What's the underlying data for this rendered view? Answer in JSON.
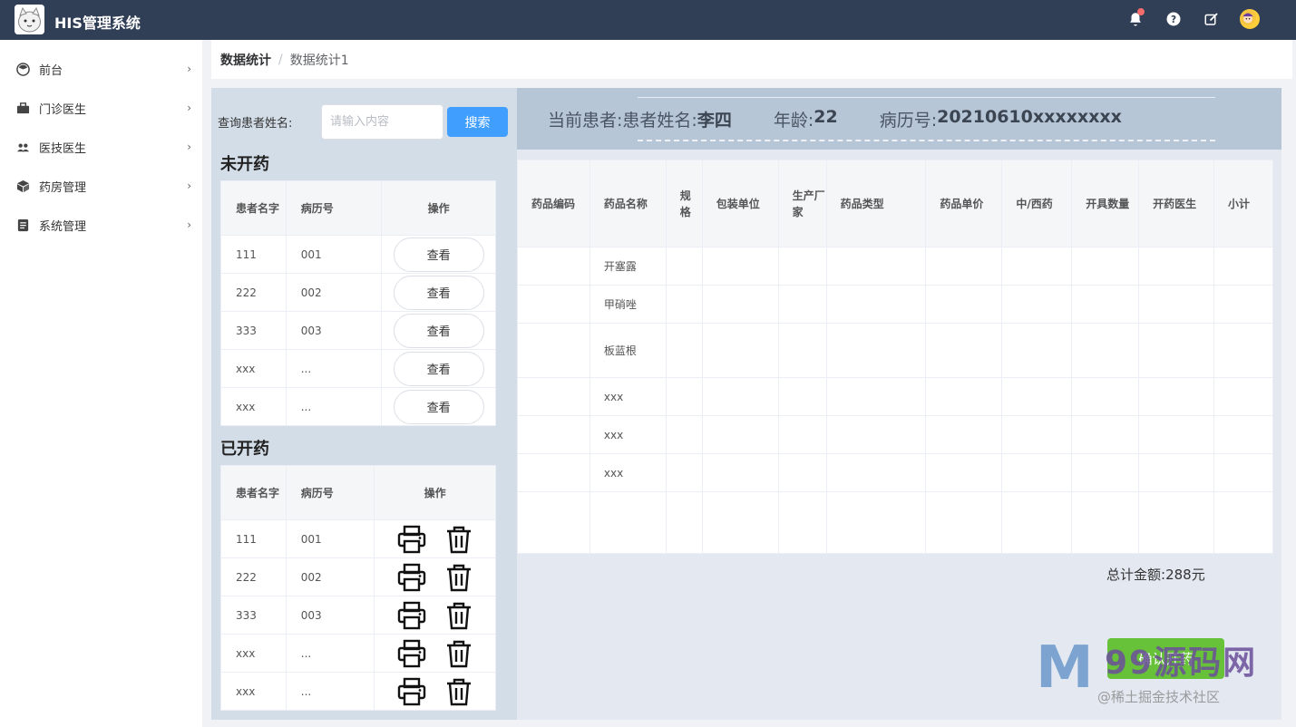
{
  "app": {
    "title": "HIS管理系统"
  },
  "sidebar": {
    "items": [
      {
        "label": "前台",
        "icon": "dashboard-icon"
      },
      {
        "label": "门诊医生",
        "icon": "briefcase-icon"
      },
      {
        "label": "医技医生",
        "icon": "users-icon"
      },
      {
        "label": "药房管理",
        "icon": "box-icon"
      },
      {
        "label": "系统管理",
        "icon": "document-icon"
      }
    ]
  },
  "breadcrumb": {
    "level1": "数据统计",
    "separator": "/",
    "level2": "数据统计1"
  },
  "search": {
    "label": "查询患者姓名:",
    "placeholder": "请输入内容",
    "button": "搜索"
  },
  "pending": {
    "title": "未开药",
    "headers": [
      "患者名字",
      "病历号",
      "操作"
    ],
    "action_label": "查看",
    "rows": [
      {
        "name": "111",
        "record": "001"
      },
      {
        "name": "222",
        "record": "002"
      },
      {
        "name": "333",
        "record": "003"
      },
      {
        "name": "xxx",
        "record": "..."
      },
      {
        "name": "xxx",
        "record": "..."
      }
    ]
  },
  "prescribed": {
    "title": "已开药",
    "headers": [
      "患者名字",
      "病历号",
      "操作"
    ],
    "rows": [
      {
        "name": "111",
        "record": "001"
      },
      {
        "name": "222",
        "record": "002"
      },
      {
        "name": "333",
        "record": "003"
      },
      {
        "name": "xxx",
        "record": "..."
      },
      {
        "name": "xxx",
        "record": "..."
      }
    ]
  },
  "patient": {
    "prefix": "当前患者:",
    "name_label": "患者姓名:",
    "name": "李四",
    "age_label": "年龄:",
    "age": "22",
    "record_label": "病历号:",
    "record": "20210610xxxxxxxx"
  },
  "drugs": {
    "headers": [
      "药品编码",
      "药品名称",
      "规格",
      "包装单位",
      "生产厂家",
      "药品类型",
      "药品单价",
      "中/西药",
      "开具数量",
      "开药医生",
      "小计"
    ],
    "rows": [
      {
        "name": "开塞露"
      },
      {
        "name": "甲硝唑"
      },
      {
        "name": "板蓝根"
      },
      {
        "name": "xxx"
      },
      {
        "name": "xxx"
      },
      {
        "name": "xxx"
      }
    ]
  },
  "total": {
    "label": "总计金额:",
    "value": "288元"
  },
  "confirm_button": "确认开药",
  "watermark": {
    "brand": "99源码网",
    "sub": "@稀土掘金技术社区"
  },
  "colors": {
    "topbar": "#303f56",
    "primary": "#409eff",
    "success": "#67c23a",
    "panel": "#d3dde8",
    "patient_bar": "#b7c6d7"
  }
}
